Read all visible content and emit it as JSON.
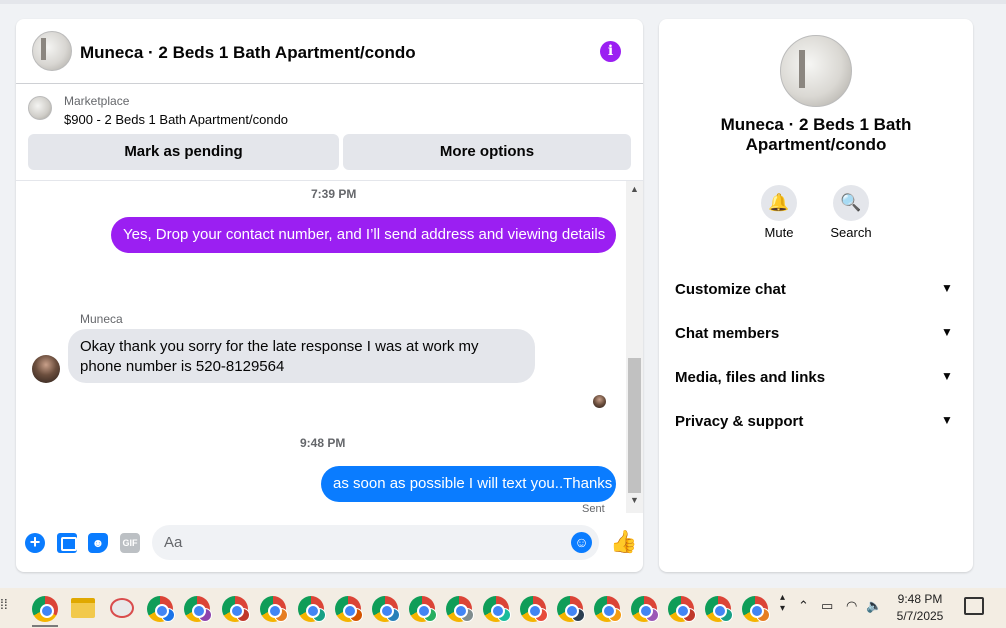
{
  "chat": {
    "header_title": "Muneca · 2 Beds 1 Bath Apartment/condo",
    "info_icon": "info-icon",
    "marketplace_label": "Marketplace",
    "listing_text": "$900 - 2 Beds 1 Bath Apartment/condo",
    "mark_pending_label": "Mark as pending",
    "more_options_label": "More options"
  },
  "messages": {
    "timestamp_1": "7:39 PM",
    "outgoing_1": "Yes,  Drop your contact number, and I’ll send address and viewing details",
    "sender_name": "Muneca",
    "incoming_1": "Okay thank you sorry for the late response I was at work my phone number is 520-8129564",
    "timestamp_2": "9:48 PM",
    "outgoing_2": "as soon as possible I will text you..Thanks",
    "sent_status": "Sent"
  },
  "composer": {
    "placeholder": "Aa",
    "icons": [
      "plus-icon",
      "photo-icon",
      "sticker-icon",
      "gif-icon",
      "emoji-icon",
      "like-icon"
    ],
    "gif_label": "GIF"
  },
  "right_panel": {
    "title": "Muneca · 2 Beds 1 Bath Apartment/condo",
    "mute_label": "Mute",
    "search_label": "Search",
    "sections": [
      "Customize chat",
      "Chat members",
      "Media, files and links",
      "Privacy & support"
    ]
  },
  "taskbar": {
    "time": "9:48 PM",
    "date": "5/7/2025"
  },
  "colors": {
    "outgoing_purple": "#9b1ff2",
    "outgoing_blue": "#0a7cff",
    "incoming_gray": "#e4e6eb",
    "background": "#f0f2f5"
  }
}
